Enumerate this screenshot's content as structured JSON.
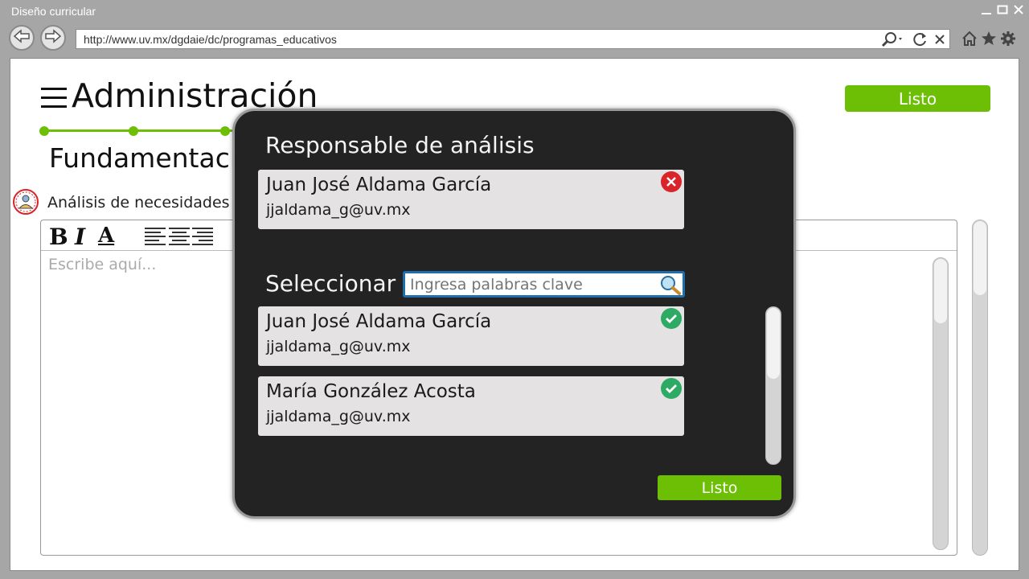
{
  "window": {
    "title": "Diseño curricular",
    "controls": [
      "minimize-icon",
      "maximize-icon",
      "close-icon"
    ]
  },
  "browser": {
    "url": "http://www.uv.mx/dgdaie/dc/programas_educativos",
    "icons": [
      "back-icon",
      "forward-icon",
      "search-icon",
      "refresh-icon",
      "stop-icon",
      "home-icon",
      "star-icon",
      "gear-icon"
    ]
  },
  "app": {
    "title": "Administración",
    "done_label": "Listo",
    "section_title": "Fundamentaci",
    "step_color": "#6cbf05"
  },
  "editor": {
    "label": "Análisis de necesidades",
    "toolbar": {
      "bold": "B",
      "italic": "I",
      "color": "A"
    },
    "placeholder": "Escribe aquí..."
  },
  "modal": {
    "title": "Responsable de análisis",
    "assigned": {
      "name": "Juan José Aldama García",
      "email": "jjaldama_g@uv.mx",
      "status": "remove"
    },
    "select_label": "Seleccionar",
    "search_placeholder": "Ingresa palabras clave",
    "candidates": [
      {
        "name": "Juan José Aldama García",
        "email": "jjaldama_g@uv.mx",
        "status": "selected"
      },
      {
        "name": "María González Acosta",
        "email": "jjaldama_g@uv.mx",
        "status": "selected"
      }
    ],
    "done_label": "Listo",
    "colors": {
      "remove": "#d9242a",
      "selected": "#2daa64",
      "accent": "#6cbf05"
    }
  }
}
